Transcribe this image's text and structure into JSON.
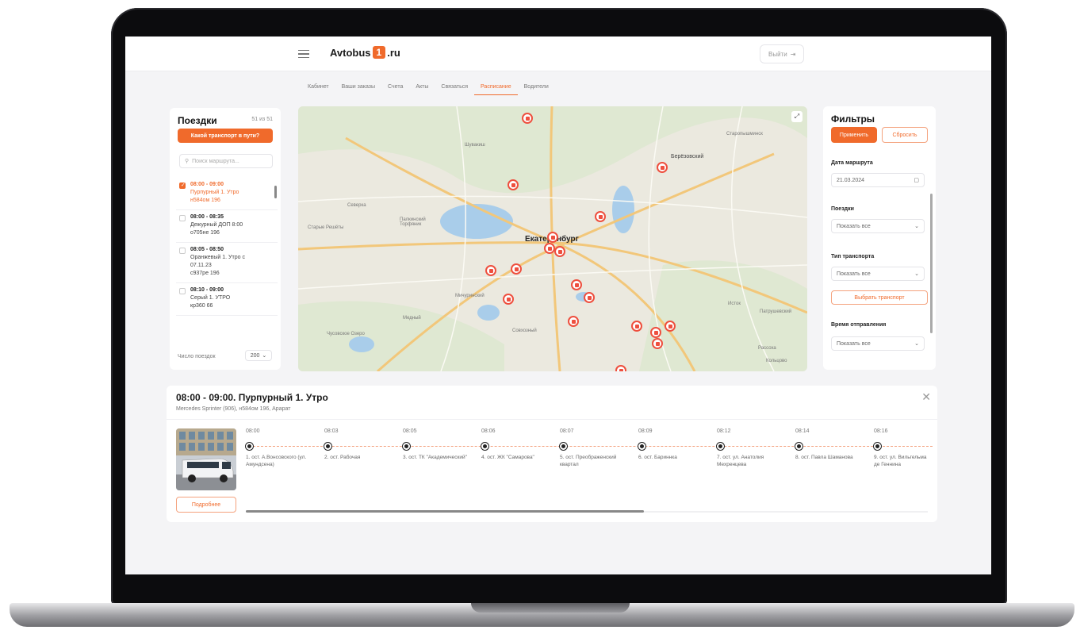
{
  "header": {
    "logo_text": "Avtobus",
    "logo_badge": "1",
    "logo_suffix": ".ru",
    "logout_label": "Выйти"
  },
  "tabs": [
    {
      "label": "Кабинет"
    },
    {
      "label": "Ваши заказы"
    },
    {
      "label": "Счета"
    },
    {
      "label": "Акты"
    },
    {
      "label": "Связаться"
    },
    {
      "label": "Расписание",
      "active": true
    },
    {
      "label": "Водители"
    }
  ],
  "trips_panel": {
    "title": "Поездки",
    "count": "51 из 51",
    "where_button": "Какой транспорт в пути?",
    "search_placeholder": "Поиск маршрута...",
    "per_page_label": "Число поездок",
    "per_page_value": "200",
    "items": [
      {
        "time": "08:00 - 09:00",
        "line1": "Пурпурный 1. Утро",
        "line2": "н584ом 196",
        "selected": true
      },
      {
        "time": "08:00 - 08:35",
        "line1": "Дежурный ДОП 8:00",
        "line2": "о705не 196"
      },
      {
        "time": "08:05 - 08:50",
        "line1": "Оранжевый 1. Утро с",
        "line2": "07.11.23",
        "line3": "с937ре 196"
      },
      {
        "time": "08:10 - 09:00",
        "line1": "Серый 1. УТРО",
        "line2": "кр360 66"
      }
    ]
  },
  "map": {
    "city": "Екатеринбург",
    "labels": [
      "Шувакиш",
      "Берёзовский",
      "Старопышминск",
      "Северка",
      "Палкинский Торфяник",
      "Старые Решёты",
      "Мичуринский",
      "Медный",
      "Чусовское Озеро",
      "Совхозный",
      "Исток",
      "Патрушевский",
      "Рассоха",
      "Кольцово"
    ],
    "expand_icon": "expand-icon",
    "pin_color": "#ee4f3e"
  },
  "filters": {
    "title": "Фильтры",
    "apply": "Применить",
    "reset": "Сбросить",
    "date_label": "Дата маршрута",
    "date_value": "21.03.2024",
    "trips_label": "Поездки",
    "trips_value": "Показать все",
    "transport_label": "Тип транспорта",
    "transport_value": "Показать все",
    "choose_transport": "Выбрать транспорт",
    "departure_label": "Время отправления",
    "departure_value": "Показать все"
  },
  "detail": {
    "title": "08:00 - 09:00. Пурпурный 1. Утро",
    "subtitle": "Mercedes Sprinter (906), н584ом 196, Арарат",
    "more_button": "Подробнее",
    "stops": [
      {
        "time": "08:00",
        "name": "1. ост. А.Вонсовского (ул. Амундсена)"
      },
      {
        "time": "08:03",
        "name": "2. ост. Рабочая"
      },
      {
        "time": "08:05",
        "name": "3. ост. ТК \"Академический\""
      },
      {
        "time": "08:06",
        "name": "4. ост. ЖК \"Самарова\""
      },
      {
        "time": "08:07",
        "name": "5. ост. Преображенский квартал"
      },
      {
        "time": "08:09",
        "name": "6. ост. Бариннка"
      },
      {
        "time": "08:12",
        "name": "7. ост. ул. Анатолия Мехренцева"
      },
      {
        "time": "08:14",
        "name": "8. ост. Павла Шаманова"
      },
      {
        "time": "08:16",
        "name": "9. ост. ул. Вильгельма де Геннина"
      }
    ]
  },
  "colors": {
    "accent": "#f06a2b",
    "pin": "#ee4f3e"
  }
}
